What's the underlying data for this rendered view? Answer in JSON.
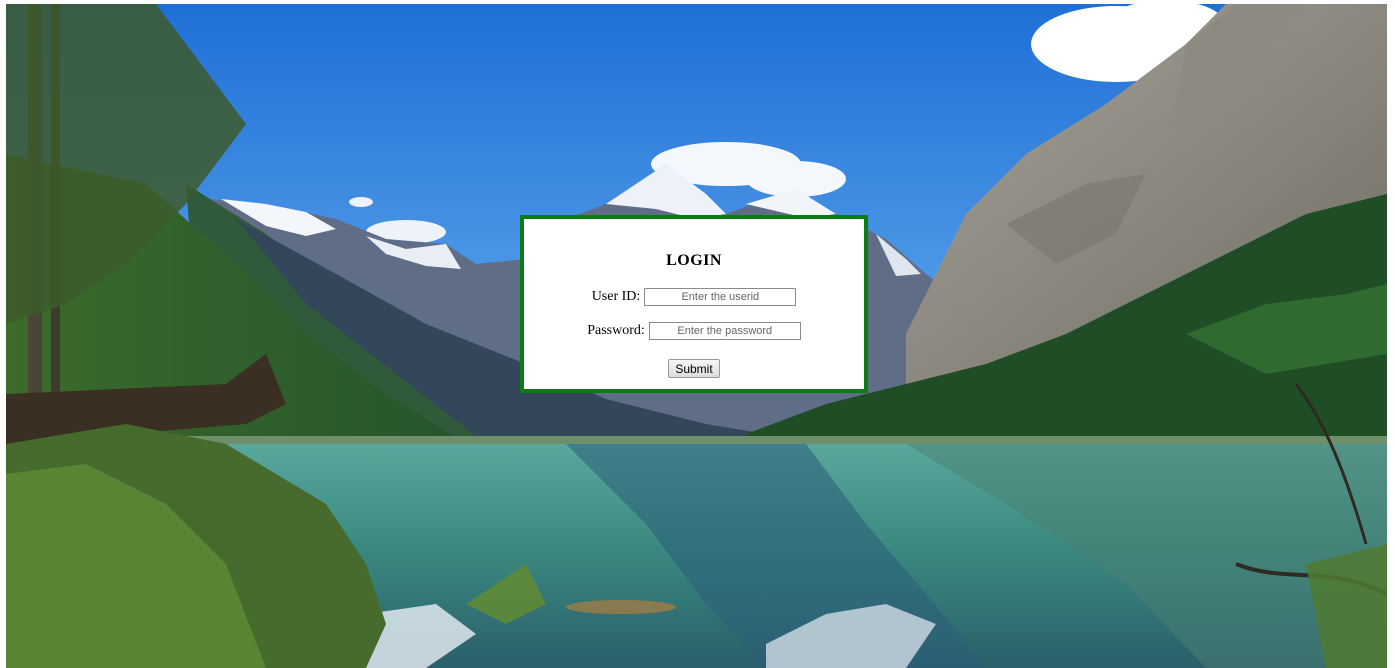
{
  "background": {
    "scene": "mountain-lake-landscape",
    "sky_color": "#2f80e0",
    "water_color": "#3f8f86",
    "forest_color": "#1f4d25"
  },
  "login": {
    "title": "LOGIN",
    "border_color": "#0b7d12",
    "userid": {
      "label": "User ID:",
      "placeholder": "Enter the userid",
      "value": ""
    },
    "password": {
      "label": "Password:",
      "placeholder": "Enter the password",
      "value": ""
    },
    "submit_label": "Submit"
  }
}
